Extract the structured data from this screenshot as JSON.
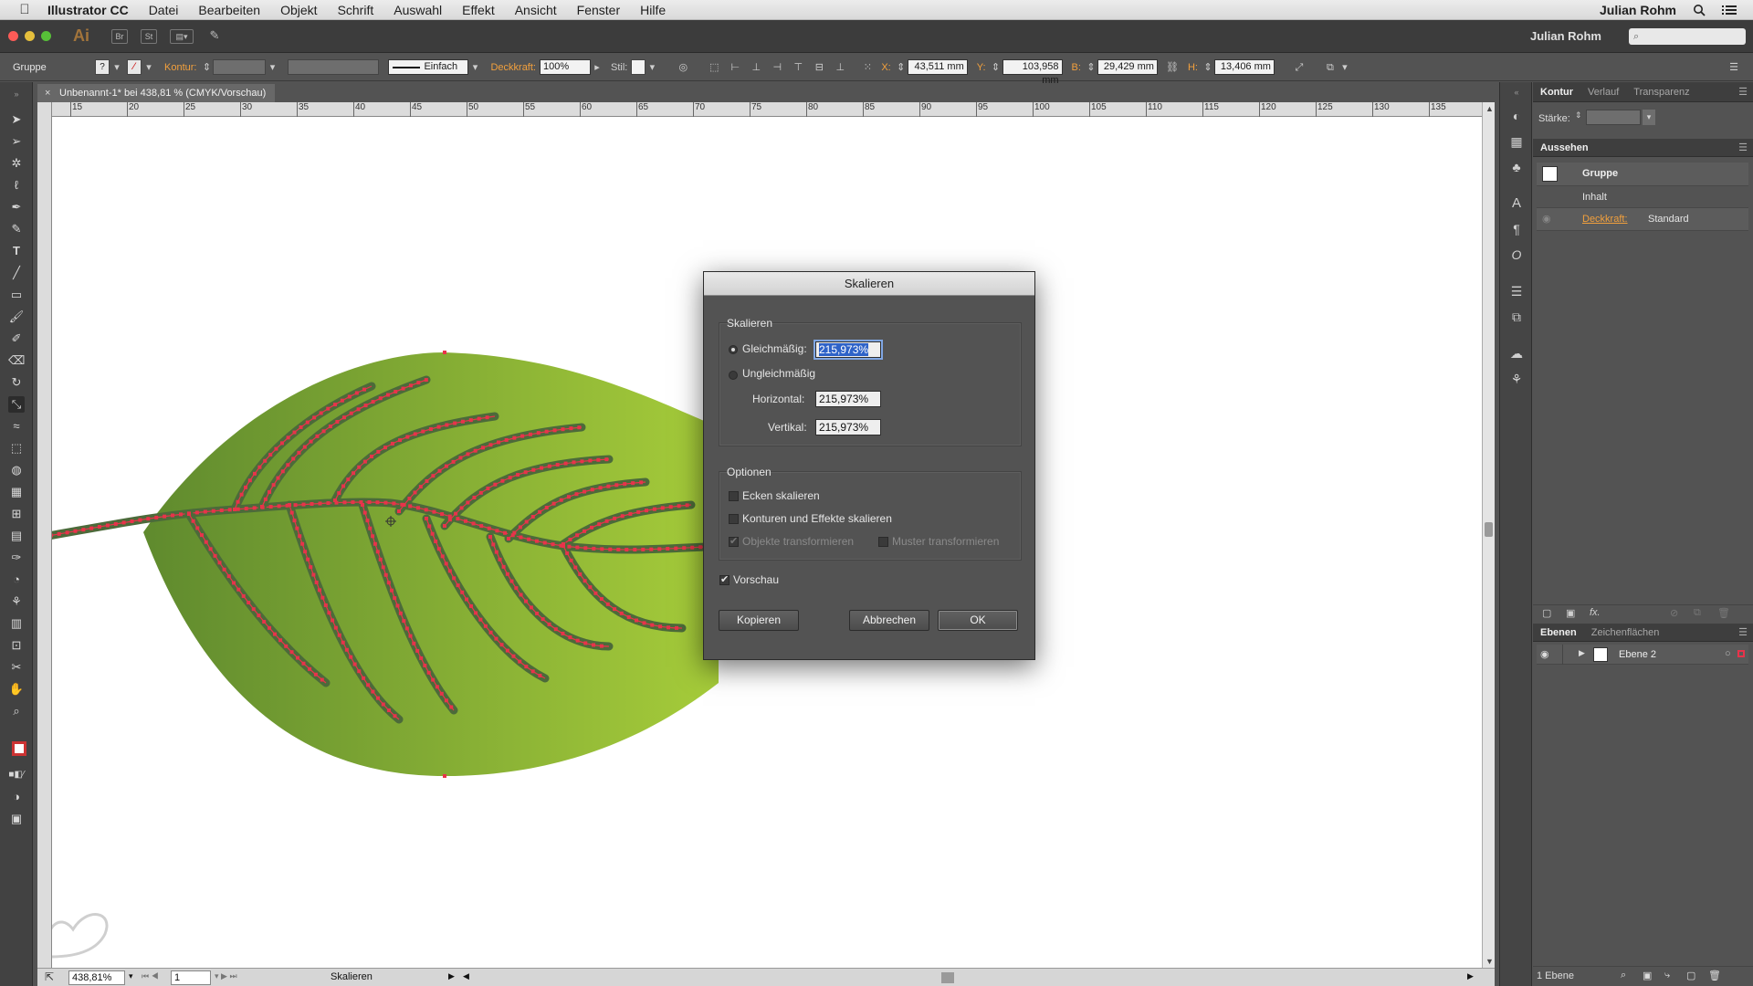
{
  "menubar": {
    "app": "Illustrator CC",
    "items": [
      "Datei",
      "Bearbeiten",
      "Objekt",
      "Schrift",
      "Auswahl",
      "Effekt",
      "Ansicht",
      "Fenster",
      "Hilfe"
    ],
    "user": "Julian Rohm"
  },
  "appbar": {
    "logo": "Ai",
    "bridge": "Br",
    "stock": "St",
    "user": "Julian Rohm"
  },
  "control": {
    "selection": "Gruppe",
    "stroke_label": "Kontur:",
    "stroke_style": "Einfach",
    "opacity_label": "Deckkraft:",
    "opacity_value": "100%",
    "style_label": "Stil:",
    "x_label": "X:",
    "x_value": "43,511 mm",
    "y_label": "Y:",
    "y_value": "103,958 mm",
    "w_label": "B:",
    "w_value": "29,429 mm",
    "h_label": "H:",
    "h_value": "13,406 mm"
  },
  "document": {
    "tab_title": "Unbenannt-1* bei 438,81 % (CMYK/Vorschau)",
    "ruler_ticks": [
      "15",
      "20",
      "25",
      "30",
      "35",
      "40",
      "45",
      "50",
      "55",
      "60",
      "65",
      "70",
      "75",
      "80",
      "85",
      "90",
      "95",
      "100",
      "105",
      "110",
      "115",
      "120",
      "125",
      "130",
      "135"
    ],
    "leaf_colors": {
      "dark": "#5f8a2e",
      "light": "#a6cc3a",
      "vein": "#4c6a3a",
      "anchor": "#e8334a"
    }
  },
  "status": {
    "zoom": "438,81%",
    "page": "1",
    "tool_name": "Skalieren"
  },
  "dialog": {
    "title": "Skalieren",
    "group_scale": "Skalieren",
    "uniform_label": "Gleichmäßig:",
    "uniform_value": "215,973%",
    "nonuniform_label": "Ungleichmäßig",
    "horizontal_label": "Horizontal:",
    "horizontal_value": "215,973%",
    "vertical_label": "Vertikal:",
    "vertical_value": "215,973%",
    "group_options": "Optionen",
    "opt_corners": "Ecken skalieren",
    "opt_strokes": "Konturen und Effekte skalieren",
    "opt_objects": "Objekte transformieren",
    "opt_pattern": "Muster transformieren",
    "preview": "Vorschau",
    "btn_copy": "Kopieren",
    "btn_cancel": "Abbrechen",
    "btn_ok": "OK"
  },
  "panels": {
    "top_tabs": [
      "Kontur",
      "Verlauf",
      "Transparenz"
    ],
    "stroke_weight_label": "Stärke:",
    "appearance_title": "Aussehen",
    "appearance_group": "Gruppe",
    "appearance_content": "Inhalt",
    "appearance_opacity_label": "Deckkraft:",
    "appearance_opacity_value": "Standard",
    "layers_tabs": [
      "Ebenen",
      "Zeichenflächen"
    ],
    "layer_name": "Ebene 2",
    "layer_count": "1 Ebene"
  },
  "colors": {
    "accent_orange": "#f2a03d",
    "selection_red": "#e8334a"
  }
}
